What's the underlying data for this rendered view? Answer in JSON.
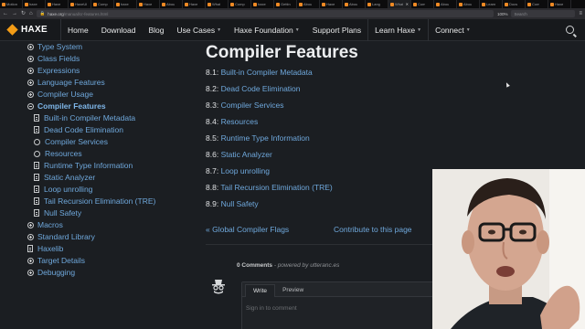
{
  "browser": {
    "tabs": [
      {
        "label": "Motion"
      },
      {
        "label": "haxe"
      },
      {
        "label": "Haxe"
      },
      {
        "label": "HaxeUI"
      },
      {
        "label": "Comp"
      },
      {
        "label": "haxe"
      },
      {
        "label": "Haxe"
      },
      {
        "label": "Abou"
      },
      {
        "label": "Haxe"
      },
      {
        "label": "What"
      },
      {
        "label": "Comp"
      },
      {
        "label": "haxe"
      },
      {
        "label": "Gettin"
      },
      {
        "label": "Abou"
      },
      {
        "label": "Haxe"
      },
      {
        "label": "Abou"
      },
      {
        "label": "Lang"
      },
      {
        "label": "What"
      },
      {
        "label": "Com"
      },
      {
        "label": "Abou"
      },
      {
        "label": "Abou"
      },
      {
        "label": "Learn"
      },
      {
        "label": "Docs"
      },
      {
        "label": "Com"
      },
      {
        "label": "Haxe"
      }
    ],
    "url_domain": "haxe",
    "url_tld": ".org",
    "url_path": "/manual/cr-features.html",
    "zoom": "100%",
    "search_placeholder": "Search"
  },
  "header": {
    "logo_text": "HAXE",
    "nav": [
      {
        "label": "Home"
      },
      {
        "label": "Download"
      },
      {
        "label": "Blog"
      },
      {
        "label": "Use Cases"
      },
      {
        "label": "Haxe Foundation"
      },
      {
        "label": "Support Plans"
      },
      {
        "label": "Learn Haxe"
      },
      {
        "label": "Connect"
      }
    ]
  },
  "sidebar": {
    "items": [
      {
        "label": "Type System"
      },
      {
        "label": "Class Fields"
      },
      {
        "label": "Expressions"
      },
      {
        "label": "Language Features"
      },
      {
        "label": "Compiler Usage"
      },
      {
        "label": "Compiler Features"
      },
      {
        "label": "Macros"
      },
      {
        "label": "Standard Library"
      },
      {
        "label": "Haxelib"
      },
      {
        "label": "Target Details"
      },
      {
        "label": "Debugging"
      }
    ],
    "current_children": [
      {
        "label": "Built-in Compiler Metadata"
      },
      {
        "label": "Dead Code Elimination"
      },
      {
        "label": "Compiler Services"
      },
      {
        "label": "Resources"
      },
      {
        "label": "Runtime Type Information"
      },
      {
        "label": "Static Analyzer"
      },
      {
        "label": "Loop unrolling"
      },
      {
        "label": "Tail Recursion Elimination (TRE)"
      },
      {
        "label": "Null Safety"
      }
    ]
  },
  "main": {
    "title": "Compiler Features",
    "toc": [
      {
        "num": "8.1:",
        "label": "Built-in Compiler Metadata"
      },
      {
        "num": "8.2:",
        "label": "Dead Code Elimination"
      },
      {
        "num": "8.3:",
        "label": "Compiler Services"
      },
      {
        "num": "8.4:",
        "label": "Resources"
      },
      {
        "num": "8.5:",
        "label": "Runtime Type Information"
      },
      {
        "num": "8.6:",
        "label": "Static Analyzer"
      },
      {
        "num": "8.7:",
        "label": "Loop unrolling"
      },
      {
        "num": "8.8:",
        "label": "Tail Recursion Elimination (TRE)"
      },
      {
        "num": "8.9:",
        "label": "Null Safety"
      }
    ],
    "prev_link": "« Global Compiler Flags",
    "contribute_link": "Contribute to this page",
    "comments_count": "0 Comments",
    "comments_powered": " - powered by utteranc.es",
    "comment_tabs": [
      {
        "label": "Write"
      },
      {
        "label": "Preview"
      }
    ],
    "comment_placeholder": "Sign in to comment"
  },
  "colors": {
    "accent": "#f39c16",
    "link": "#6fa8dc",
    "background": "#1b1e22"
  }
}
